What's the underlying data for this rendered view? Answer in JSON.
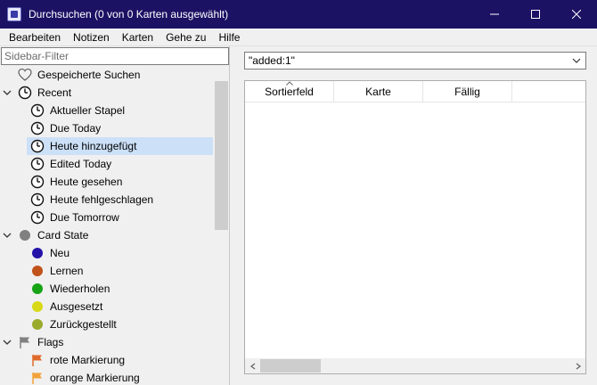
{
  "window": {
    "title": "Durchsuchen (0 von 0 Karten ausgewählt)"
  },
  "menu": [
    "Bearbeiten",
    "Notizen",
    "Karten",
    "Gehe zu",
    "Hilfe"
  ],
  "sidebar": {
    "filter_placeholder": "Sidebar-Filter",
    "items": [
      {
        "label": "Gespeicherte Suchen",
        "icon": "heart-icon",
        "level": 1,
        "expander": ""
      },
      {
        "label": "Recent",
        "icon": "clock-icon",
        "level": 1,
        "expander": "expanded"
      },
      {
        "label": "Aktueller Stapel",
        "icon": "clock-icon",
        "level": 2
      },
      {
        "label": "Due Today",
        "icon": "clock-icon",
        "level": 2
      },
      {
        "label": "Heute hinzugefügt",
        "icon": "clock-icon",
        "level": 2,
        "selected": true
      },
      {
        "label": "Edited Today",
        "icon": "clock-icon",
        "level": 2
      },
      {
        "label": "Heute gesehen",
        "icon": "clock-icon",
        "level": 2
      },
      {
        "label": "Heute fehlgeschlagen",
        "icon": "clock-icon",
        "level": 2
      },
      {
        "label": "Due Tomorrow",
        "icon": "clock-icon",
        "level": 2
      },
      {
        "label": "Card State",
        "icon": "state-dot-icon",
        "level": 1,
        "expander": "expanded",
        "color": "#808080"
      },
      {
        "label": "Neu",
        "icon": "dot-icon",
        "level": 2,
        "color": "#2412a8"
      },
      {
        "label": "Lernen",
        "icon": "dot-icon",
        "level": 2,
        "color": "#c0521a"
      },
      {
        "label": "Wiederholen",
        "icon": "dot-icon",
        "level": 2,
        "color": "#16a416"
      },
      {
        "label": "Ausgesetzt",
        "icon": "dot-icon",
        "level": 2,
        "color": "#d8d816"
      },
      {
        "label": "Zurückgestellt",
        "icon": "dot-icon",
        "level": 2,
        "color": "#9aaa2c"
      },
      {
        "label": "Flags",
        "icon": "flag-icon",
        "level": 1,
        "expander": "expanded",
        "color": "#808080"
      },
      {
        "label": "rote Markierung",
        "icon": "flag-icon",
        "level": 2,
        "color": "#e06a2a"
      },
      {
        "label": "orange Markierung",
        "icon": "flag-icon",
        "level": 2,
        "color": "#f2a23c"
      }
    ]
  },
  "search": {
    "value": "\"added:1\""
  },
  "table": {
    "columns": [
      "Sortierfeld",
      "Karte",
      "Fällig"
    ]
  }
}
